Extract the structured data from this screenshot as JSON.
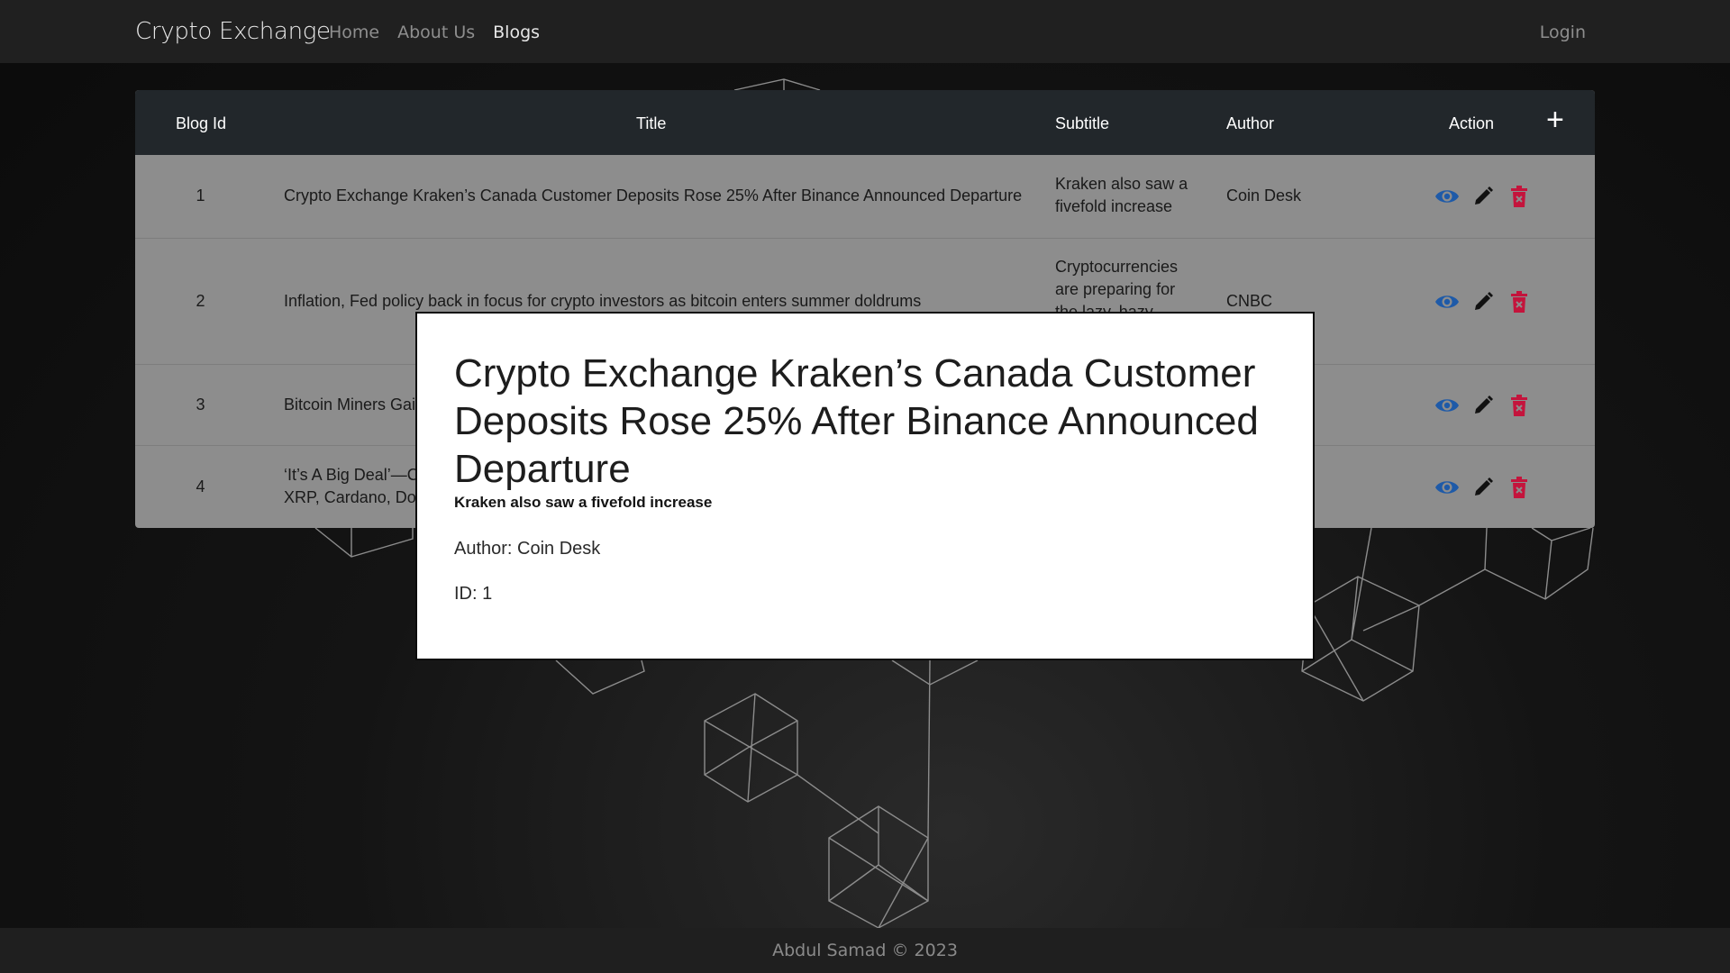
{
  "navbar": {
    "brand": "Crypto Exchange",
    "links": [
      {
        "label": "Home"
      },
      {
        "label": "About Us"
      },
      {
        "label": "Blogs"
      }
    ],
    "login_label": "Login"
  },
  "table": {
    "headers": {
      "id": "Blog Id",
      "title": "Title",
      "subtitle": "Subtitle",
      "author": "Author",
      "action": "Action",
      "add": "+"
    },
    "rows": [
      {
        "id": "1",
        "title": "Crypto Exchange Kraken’s Canada Customer Deposits Rose 25% After Binance Announced Departure",
        "subtitle": "Kraken also saw a fivefold increase",
        "author": "Coin Desk"
      },
      {
        "id": "2",
        "title": "Inflation, Fed policy back in focus for crypto investors as bitcoin enters summer doldrums",
        "subtitle": "Cryptocurrencies are preparing for the lazy, hazy",
        "author": "CNBC"
      },
      {
        "id": "3",
        "title": "Bitcoin Miners Gai",
        "subtitle": "",
        "author": ""
      },
      {
        "id": "4",
        "title": "‘It’s A Big Deal’—C XRP, Cardano, Do",
        "subtitle": "",
        "author": ""
      }
    ],
    "action_icons": [
      "eye-icon",
      "pencil-icon",
      "trash-icon"
    ]
  },
  "modal": {
    "title": "Crypto Exchange Kraken’s Canada Customer Deposits Rose 25% After Binance Announced Departure",
    "subtitle": "Kraken also saw a fivefold increase",
    "author": "Author: Coin Desk",
    "id": "ID: 1"
  },
  "footer": {
    "text": "Abdul Samad © 2023"
  },
  "colors": {
    "navbar_bg": "#202020",
    "table_header_bg": "#22272b",
    "table_body_bg": "#8d8d8d",
    "view_icon": "#1e5aa8",
    "edit_icon": "#111111",
    "delete_icon": "#c4143c"
  }
}
